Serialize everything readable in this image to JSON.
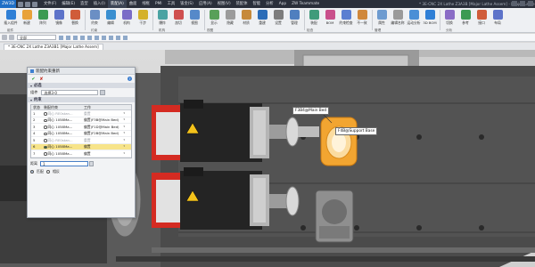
{
  "window": {
    "app_mark": "ZW3D",
    "title": "* 3E-CNC 2X Lathe Z3A3B [Major Lathe Assem] - [Major Lathe Assem]"
  },
  "menu": {
    "items": [
      "文件(F)",
      "编辑(E)",
      "造型",
      "插入(I)",
      "装配(A)",
      "曲面",
      "线框",
      "PMI",
      "工具",
      "钣金(S)",
      "应用(A)",
      "视图(V)",
      "装配体",
      "智能",
      "分析",
      "App",
      "ZW Teammate"
    ],
    "active_index": 4
  },
  "ribbon": {
    "buttons": [
      {
        "label": "插入组件",
        "color": "#2f7fd6"
      },
      {
        "label": "新建",
        "color": "#e8a23a"
      },
      {
        "label": "阵列",
        "color": "#3c9a52"
      },
      {
        "label": "镜像",
        "color": "#5d73c9"
      },
      {
        "label": "替换",
        "color": "#d05c3a"
      },
      {
        "label": "约束",
        "color": "#6b8fc4"
      },
      {
        "label": "编辑",
        "color": "#3a8fd0"
      },
      {
        "label": "机构",
        "color": "#7a6cc7"
      },
      {
        "label": "干涉",
        "color": "#d4b12b"
      },
      {
        "label": "爆炸",
        "color": "#4aa3a3"
      },
      {
        "label": "剖切",
        "color": "#cf4f4f"
      },
      {
        "label": "视图",
        "color": "#5689c9"
      },
      {
        "label": "显示",
        "color": "#58a059"
      },
      {
        "label": "隐藏",
        "color": "#9b9b9b"
      },
      {
        "label": "材质",
        "color": "#c68a3b"
      },
      {
        "label": "重建",
        "color": "#2c6db8"
      },
      {
        "label": "设置",
        "color": "#7d7d7d"
      },
      {
        "label": "管理",
        "color": "#4f7fbf"
      },
      {
        "label": "装配",
        "color": "#3f9b7a"
      },
      {
        "label": "BOM",
        "color": "#c94f8b"
      },
      {
        "label": "约束检查",
        "color": "#5b7fd1"
      },
      {
        "label": "不一致",
        "color": "#d0883b"
      },
      {
        "label": "属性",
        "color": "#6d9bd0"
      },
      {
        "label": "编辑名称",
        "color": "#9a9a9a"
      },
      {
        "label": "运动分析",
        "color": "#4b8fd6"
      },
      {
        "label": "3D BOM",
        "color": "#2f7fd6"
      },
      {
        "label": "切换",
        "color": "#8a6cc6"
      },
      {
        "label": "参考",
        "color": "#3c9a52"
      },
      {
        "label": "接口",
        "color": "#d05c3a"
      },
      {
        "label": "布局",
        "color": "#5d73c9"
      }
    ],
    "groups": [
      "组件",
      "约束",
      "机构",
      "视图",
      "检查",
      "管理",
      "分析"
    ]
  },
  "feature_bar": {
    "filter_value": "全部"
  },
  "doc_tab": {
    "label": "* 3E-CNC 2X Lathe Z3A3B1 [Major Lathe Assem]"
  },
  "panel": {
    "title": "装配约束重新",
    "ok_icon": "check-icon",
    "cancel_icon": "cross-icon",
    "required_section": "必选",
    "component_label": "组件",
    "component_value": "选择3-0",
    "sequence_section": "约束",
    "columns": [
      "状态",
      "装配约束",
      "工作"
    ],
    "rows": [
      {
        "num": "1",
        "name": "同心 RE0stan...",
        "work": "重置",
        "selected": false,
        "dim": true
      },
      {
        "num": "2",
        "name": "同心 1058Ma...",
        "work": "偏置(F3B@Main Bed)",
        "selected": false,
        "dim": false
      },
      {
        "num": "3",
        "name": "同心 1058Ma...",
        "work": "偏置(F1D@Main Bed)",
        "selected": false,
        "dim": false
      },
      {
        "num": "4",
        "name": "同心 1058Ma...",
        "work": "偏置(F2B@Main Bed)",
        "selected": false,
        "dim": false
      },
      {
        "num": "5",
        "name": "同心 RE0stan...",
        "work": "重置",
        "selected": false,
        "dim": true
      },
      {
        "num": "6",
        "name": "同心 1058Ma...",
        "work": "偏置",
        "selected": true,
        "dim": false
      },
      {
        "num": "7",
        "name": "同心 1058Ma...",
        "work": "偏置",
        "selected": false,
        "dim": false
      }
    ],
    "footer_label": "距离",
    "footer_value": "1",
    "radio_options": [
      "匹配",
      "相反"
    ],
    "radio_selected": 0
  },
  "viewport": {
    "callouts": [
      "F3B4@Main Bed",
      "F4B@Support Base"
    ],
    "colors": {
      "motor_red": "#d42b22",
      "motor_dark": "#242424",
      "highlight_orange": "#f2a531",
      "warning_yellow": "#f4c21b"
    }
  }
}
